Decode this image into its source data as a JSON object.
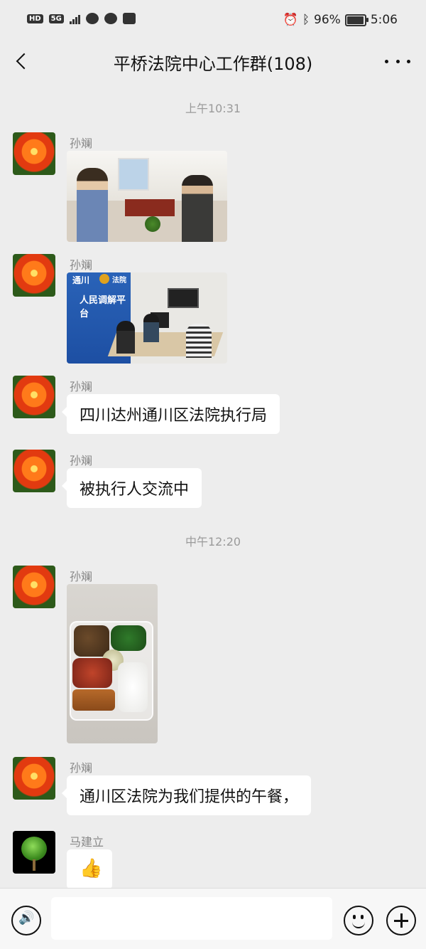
{
  "status_bar": {
    "hd_label": "HD",
    "network_label": "5G",
    "battery_text": "96%",
    "battery_level": 0.96,
    "time": "5:06"
  },
  "header": {
    "title": "平桥法院中心工作群(108)",
    "back_icon": "chevron-left-icon",
    "more_icon": "more-dots-icon"
  },
  "messages": [
    {
      "type": "timestamp",
      "text": "上午10:31"
    },
    {
      "type": "image",
      "sender": "孙斓",
      "avatar": "flower",
      "image_subject": "office-meeting-photo"
    },
    {
      "type": "image",
      "sender": "孙斓",
      "avatar": "flower",
      "image_subject": "mediation-room-photo",
      "image_texts": [
        "通川",
        "法院",
        "人民调解平台"
      ]
    },
    {
      "type": "text",
      "sender": "孙斓",
      "avatar": "flower",
      "text": "四川达州通川区法院执行局"
    },
    {
      "type": "text",
      "sender": "孙斓",
      "avatar": "flower",
      "text": "被执行人交流中"
    },
    {
      "type": "timestamp",
      "text": "中午12:20"
    },
    {
      "type": "image",
      "sender": "孙斓",
      "avatar": "flower",
      "image_subject": "lunch-box-photo"
    },
    {
      "type": "text",
      "sender": "孙斓",
      "avatar": "flower",
      "text": "通川区法院为我们提供的午餐，"
    },
    {
      "type": "sticker",
      "sender": "马建立",
      "avatar": "tree",
      "text": "👍"
    }
  ],
  "input_bar": {
    "voice_icon": "voice-icon",
    "emoji_icon": "emoji-icon",
    "plus_icon": "plus-icon",
    "input_value": ""
  },
  "colors": {
    "background": "#ededed",
    "bubble": "#ffffff",
    "muted_text": "#9a9a9a"
  }
}
